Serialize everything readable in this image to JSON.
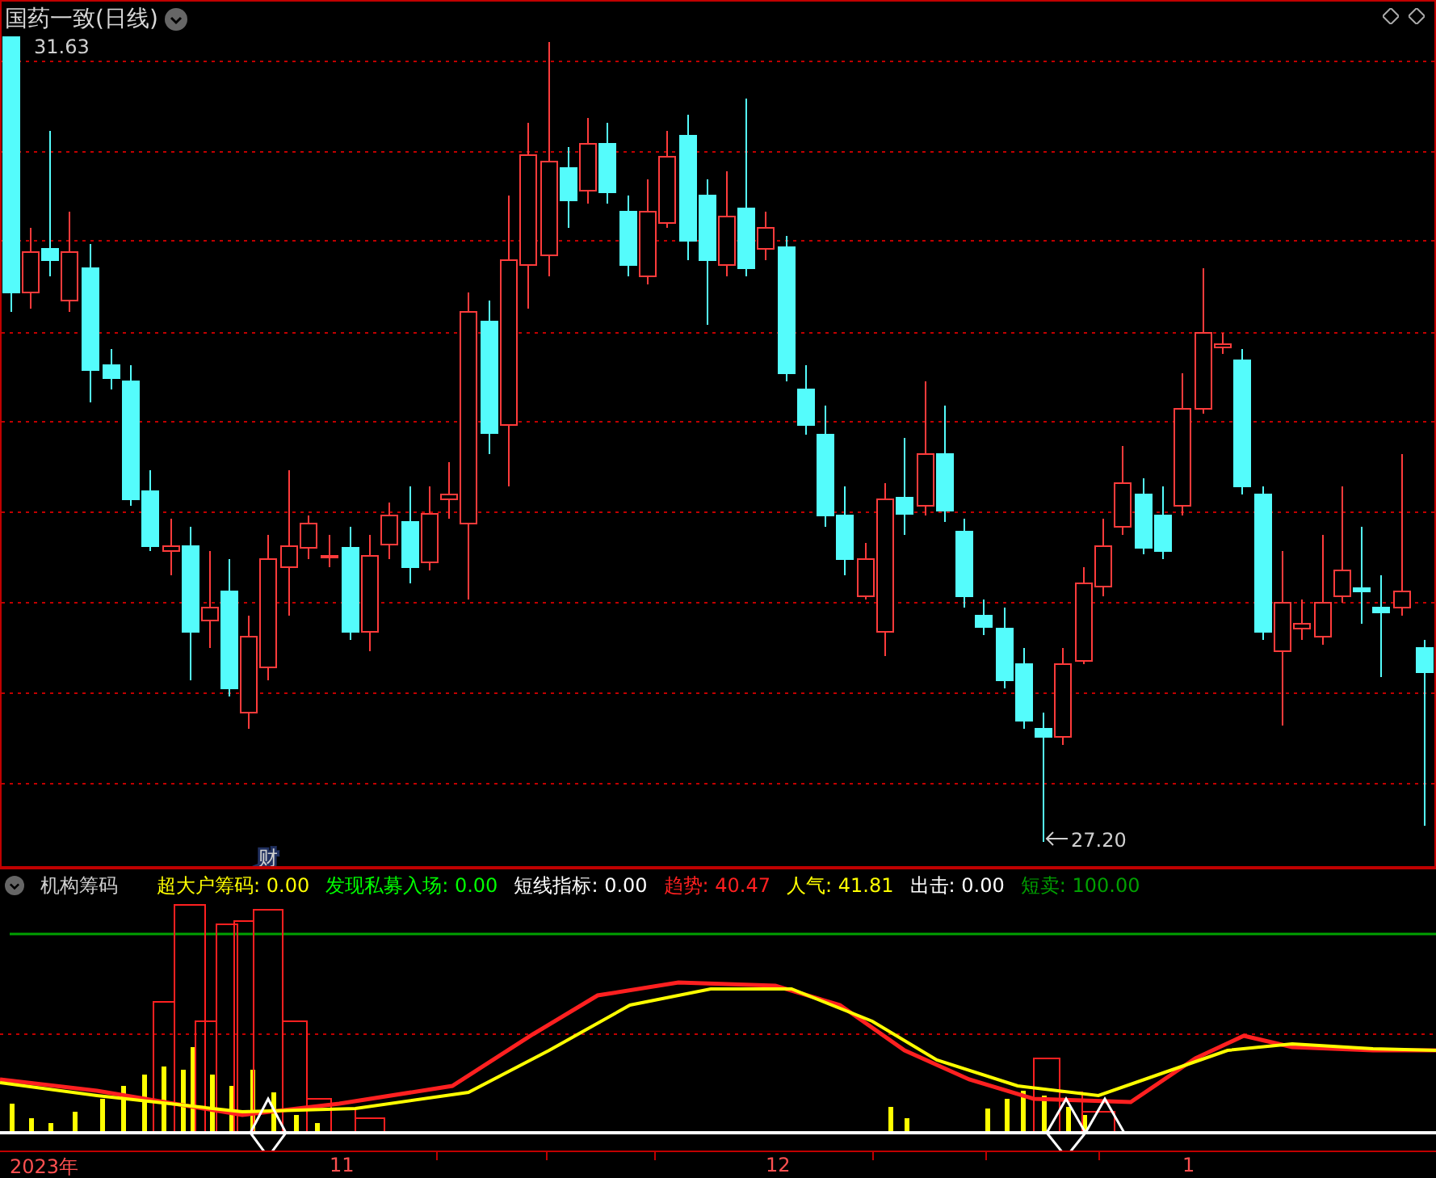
{
  "chart": {
    "title": "国药一致(日线)",
    "high_label": "31.63",
    "low_label": "27.20",
    "event_marker": "财"
  },
  "indicator": {
    "name": "机构筹码",
    "legend": [
      {
        "label": "超大户筹码:",
        "value": "0.00",
        "color": "#ffff00"
      },
      {
        "label": "发现私募入场:",
        "value": "0.00",
        "color": "#00ff00"
      },
      {
        "label": "短线指标:",
        "value": "0.00",
        "color": "#ffffff"
      },
      {
        "label": "趋势:",
        "value": "40.47",
        "color": "#ff2020"
      },
      {
        "label": "人气:",
        "value": "41.81",
        "color": "#ffff00"
      },
      {
        "label": "出击:",
        "value": "0.00",
        "color": "#ffffff"
      },
      {
        "label": "短卖:",
        "value": "100.00",
        "color": "#00a000"
      }
    ]
  },
  "time_axis": {
    "labels": [
      "2023年",
      "11",
      "12",
      "1"
    ]
  }
}
